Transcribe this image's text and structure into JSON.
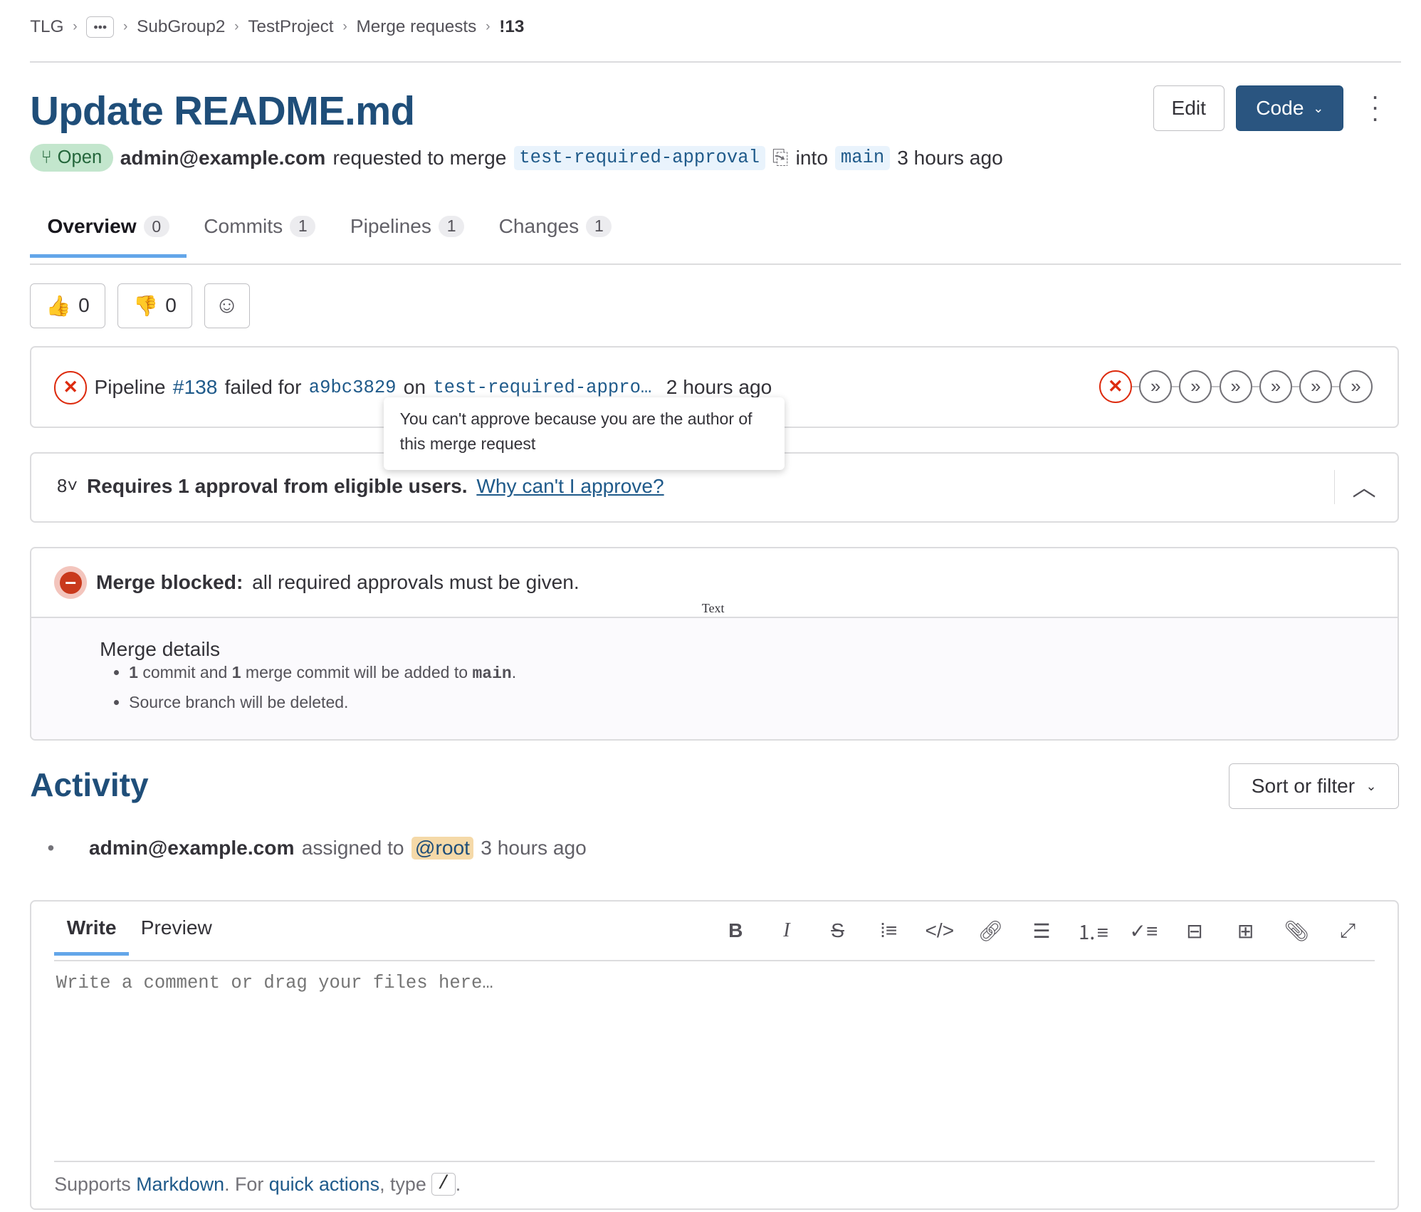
{
  "breadcrumb": [
    "TLG",
    "•••",
    "SubGroup2",
    "TestProject",
    "Merge requests",
    "!13"
  ],
  "title": "Update README.md",
  "header": {
    "edit": "Edit",
    "code": "Code"
  },
  "meta": {
    "status": "Open",
    "author": "admin@example.com",
    "text1": "requested to merge",
    "source": "test-required-approval",
    "into": "into",
    "target": "main",
    "time": "3 hours ago"
  },
  "tabs": [
    {
      "label": "Overview",
      "count": "0"
    },
    {
      "label": "Commits",
      "count": "1"
    },
    {
      "label": "Pipelines",
      "count": "1"
    },
    {
      "label": "Changes",
      "count": "1"
    }
  ],
  "reactions": {
    "up": "0",
    "down": "0"
  },
  "pipeline": {
    "prefix": "Pipeline",
    "id": "#138",
    "failed": "failed for",
    "sha": "a9bc3829",
    "on": "on",
    "branch": "test-required-appro…",
    "time": "2 hours ago"
  },
  "tooltip": "You can't approve because you are the author of this merge request",
  "approval": {
    "text": "Requires 1 approval from eligible users.",
    "link": "Why can't I approve?"
  },
  "merge": {
    "bold": "Merge blocked:",
    "text": "all required approvals must be given.",
    "stray": "Text",
    "details_title": "Merge details",
    "d1a": "1",
    "d1b": "commit and",
    "d1c": "1",
    "d1d": "merge commit will be added to",
    "d1e": "main",
    "d1f": ".",
    "d2": "Source branch will be deleted."
  },
  "activity": {
    "title": "Activity",
    "sort": "Sort or filter",
    "item": {
      "author": "admin@example.com",
      "text": "assigned to",
      "mention": "@root",
      "time": "3 hours ago"
    }
  },
  "editor": {
    "write": "Write",
    "preview": "Preview",
    "placeholder": "Write a comment or drag your files here…",
    "f1": "Supports",
    "f2": "Markdown",
    "f3": ". For",
    "f4": "quick actions",
    "f5": ", type",
    "f6": "/",
    "f7": "."
  },
  "colors": {
    "primary": "#1f4e79",
    "danger": "#dd2b0e",
    "success": "#24663b"
  }
}
